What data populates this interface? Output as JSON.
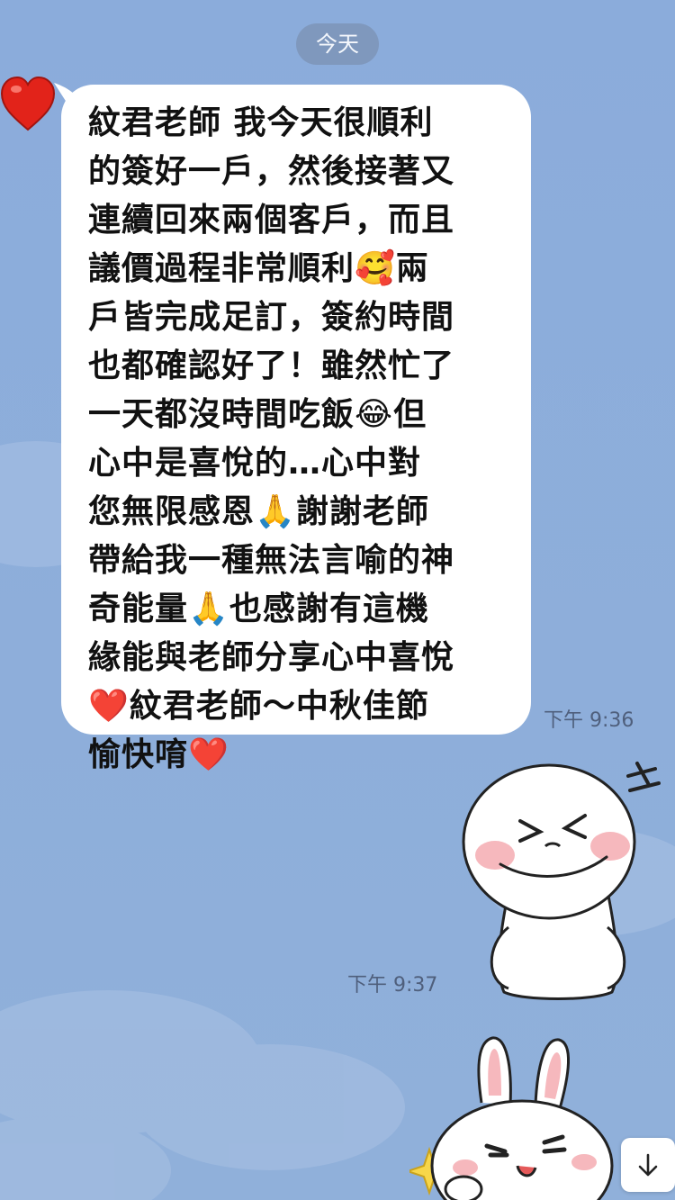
{
  "date_separator": "今天",
  "message": {
    "text": "紋君老師 我今天很順利\n的簽好一戶，然後接著又\n連續回來兩個客戶，而且\n議價過程非常順利🥰兩\n戶皆完成足訂，簽約時間\n也都確認好了！雖然忙了\n一天都沒時間吃飯😂但\n心中是喜悅的…心中對\n您無限感恩🙏謝謝老師\n帶給我一種無法言喻的神\n奇能量🙏也感謝有這機\n緣能與老師分享心中喜悅\n❤️紋君老師～中秋佳節\n愉快唷❤️",
    "time": "下午 9:36"
  },
  "sticker_brown": {
    "time": "下午 9:37",
    "icon": "line-brown-laughing-sticker"
  },
  "sticker_cony": {
    "icon": "line-cony-laughing-sticker"
  },
  "scroll_button": {
    "icon": "arrow-down-icon"
  },
  "avatar": {
    "icon": "red-heart-avatar-icon"
  },
  "colors": {
    "background": "#8caedb",
    "bubble": "#ffffff",
    "pill": "#7f98bd"
  }
}
